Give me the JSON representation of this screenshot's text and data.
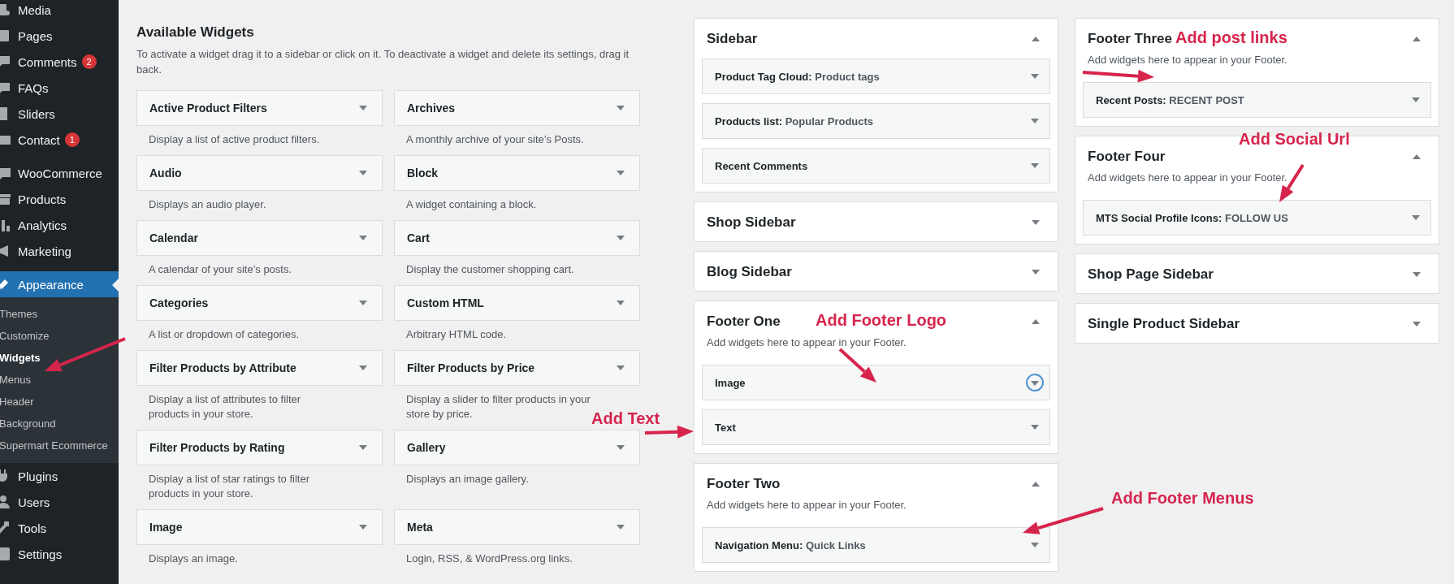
{
  "admin_menu": [
    {
      "items": [
        {
          "label": "Media",
          "selected": false
        },
        {
          "label": "Pages",
          "selected": false
        },
        {
          "label": "Comments",
          "badge": "2",
          "selected": false
        },
        {
          "label": "FAQs",
          "selected": false
        },
        {
          "label": "Sliders",
          "selected": false
        },
        {
          "label": "Contact",
          "badge": "1",
          "selected": false
        }
      ]
    },
    {
      "items": [
        {
          "label": "WooCommerce",
          "selected": false
        },
        {
          "label": "Products",
          "selected": false
        },
        {
          "label": "Analytics",
          "selected": false
        },
        {
          "label": "Marketing",
          "selected": false
        }
      ]
    },
    {
      "items": [
        {
          "label": "Appearance",
          "selected": true,
          "children": [
            {
              "label": "Themes",
              "selected": false
            },
            {
              "label": "Customize",
              "selected": false
            },
            {
              "label": "Widgets",
              "selected": true
            },
            {
              "label": "Menus",
              "selected": false
            },
            {
              "label": "Header",
              "selected": false
            },
            {
              "label": "Background",
              "selected": false
            },
            {
              "label": "Supermart Ecommerce",
              "selected": false
            }
          ]
        },
        {
          "label": "Plugins",
          "selected": false
        },
        {
          "label": "Users",
          "selected": false
        },
        {
          "label": "Tools",
          "selected": false
        },
        {
          "label": "Settings",
          "selected": false
        }
      ]
    }
  ],
  "available_widgets": {
    "title": "Available Widgets",
    "description": "To activate a widget drag it to a sidebar or click on it. To deactivate a widget and delete its settings, drag it back.",
    "widgets": [
      {
        "name": "Active Product Filters",
        "description": "Display a list of active product filters."
      },
      {
        "name": "Archives",
        "description": "A monthly archive of your site’s Posts."
      },
      {
        "name": "Audio",
        "description": "Displays an audio player."
      },
      {
        "name": "Block",
        "description": "A widget containing a block."
      },
      {
        "name": "Calendar",
        "description": "A calendar of your site’s posts."
      },
      {
        "name": "Cart",
        "description": "Display the customer shopping cart."
      },
      {
        "name": "Categories",
        "description": "A list or dropdown of categories."
      },
      {
        "name": "Custom HTML",
        "description": "Arbitrary HTML code."
      },
      {
        "name": "Filter Products by Attribute",
        "description": "Display a list of attributes to filter products in your store."
      },
      {
        "name": "Filter Products by Price",
        "description": "Display a slider to filter products in your store by price."
      },
      {
        "name": "Filter Products by Rating",
        "description": "Display a list of star ratings to filter products in your store."
      },
      {
        "name": "Gallery",
        "description": "Displays an image gallery."
      },
      {
        "name": "Image",
        "description": "Displays an image."
      },
      {
        "name": "Meta",
        "description": "Login, RSS, & WordPress.org links."
      }
    ]
  },
  "widget_area_columns": [
    {
      "areas": [
        {
          "title": "Sidebar",
          "expanded": true,
          "widgets": [
            {
              "name": "Product Tag Cloud:",
              "subtitle": "Product tags",
              "focused": false
            },
            {
              "name": "Products list:",
              "subtitle": "Popular Products",
              "focused": false
            },
            {
              "name": "Recent Comments",
              "focused": false
            }
          ]
        },
        {
          "title": "Shop Sidebar",
          "expanded": false
        },
        {
          "title": "Blog Sidebar",
          "expanded": false
        },
        {
          "title": "Footer One",
          "expanded": true,
          "description": "Add widgets here to appear in your Footer.",
          "widgets": [
            {
              "name": "Image",
              "focused": true
            },
            {
              "name": "Text",
              "focused": false
            }
          ]
        },
        {
          "title": "Footer Two",
          "expanded": true,
          "description": "Add widgets here to appear in your Footer.",
          "widgets": [
            {
              "name": "Navigation Menu:",
              "subtitle": "Quick Links",
              "focused": false
            }
          ]
        }
      ]
    },
    {
      "areas": [
        {
          "title": "Footer Three",
          "expanded": true,
          "description": "Add widgets here to appear in your Footer.",
          "widgets": [
            {
              "name": "Recent Posts:",
              "subtitle": "RECENT POST",
              "focused": false
            }
          ]
        },
        {
          "title": "Footer Four",
          "expanded": true,
          "description": "Add widgets here to appear in your Footer.",
          "widgets": [
            {
              "name": "MTS Social Profile Icons:",
              "subtitle": "FOLLOW US",
              "focused": false
            }
          ]
        },
        {
          "title": "Shop Page Sidebar",
          "expanded": false
        },
        {
          "title": "Single Product Sidebar",
          "expanded": false
        }
      ]
    }
  ],
  "annotations": [
    {
      "text": "Add post links"
    },
    {
      "text": "Add Social Url"
    },
    {
      "text": "Add Footer Logo"
    },
    {
      "text": "Add Text"
    },
    {
      "text": "Add Footer Menus"
    }
  ]
}
